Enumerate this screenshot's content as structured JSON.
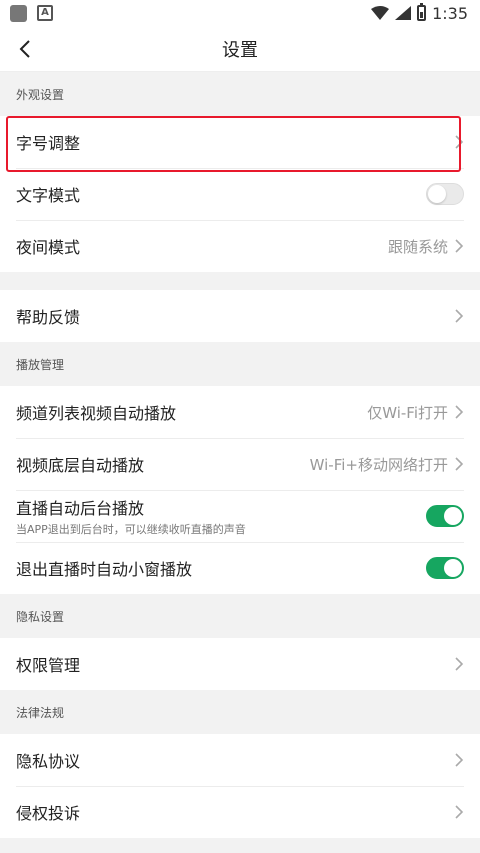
{
  "status_bar": {
    "time": "1:35"
  },
  "header": {
    "title": "设置"
  },
  "sections": {
    "appearance": {
      "title": "外观设置",
      "font_size": "字号调整",
      "text_mode": "文字模式",
      "night_mode": "夜间模式",
      "night_mode_value": "跟随系统"
    },
    "help": {
      "feedback": "帮助反馈"
    },
    "playback": {
      "title": "播放管理",
      "channel_autoplay": "频道列表视频自动播放",
      "channel_autoplay_value": "仅Wi-Fi打开",
      "bottom_autoplay": "视频底层自动播放",
      "bottom_autoplay_value": "Wi-Fi+移动网络打开",
      "live_background": "直播自动后台播放",
      "live_background_sub": "当APP退出到后台时，可以继续收听直播的声音",
      "pip": "退出直播时自动小窗播放"
    },
    "privacy": {
      "title": "隐私设置",
      "permissions": "权限管理"
    },
    "legal": {
      "title": "法律法规",
      "privacy_policy": "隐私协议",
      "infringement": "侵权投诉"
    }
  },
  "toggles": {
    "text_mode": false,
    "live_background": true,
    "pip": true
  },
  "colors": {
    "accent_green": "#16a660",
    "highlight_red": "#e8192c"
  }
}
